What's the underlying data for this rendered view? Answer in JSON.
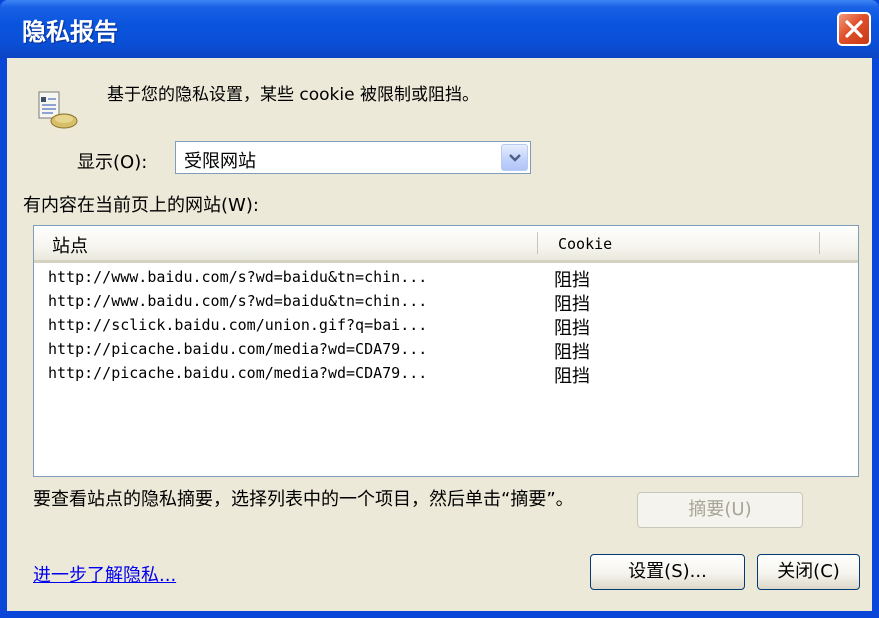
{
  "window": {
    "title": "隐私报告"
  },
  "intro": {
    "text": "基于您的隐私设置，某些 cookie 被限制或阻挡。"
  },
  "display": {
    "label": "显示(O):",
    "selected": "受限网站"
  },
  "list": {
    "label": "有内容在当前页上的网站(W):",
    "columns": [
      "站点",
      "Cookie"
    ],
    "rows": [
      {
        "site": "http://www.baidu.com/s?wd=baidu&tn=chin...",
        "status": "阻挡"
      },
      {
        "site": "http://www.baidu.com/s?wd=baidu&tn=chin...",
        "status": "阻挡"
      },
      {
        "site": "http://sclick.baidu.com/union.gif?q=bai...",
        "status": "阻挡"
      },
      {
        "site": "http://picache.baidu.com/media?wd=CDA79...",
        "status": "阻挡"
      },
      {
        "site": "http://picache.baidu.com/media?wd=CDA79...",
        "status": "阻挡"
      }
    ]
  },
  "summary": {
    "text": "要查看站点的隐私摘要，选择列表中的一个项目，然后单击“摘要”。",
    "button": "摘要(U)"
  },
  "footer": {
    "learn_more": "进一步了解隐私...",
    "settings_button": "设置(S)...",
    "close_button": "关闭(C)"
  },
  "icons": {
    "close": "close-icon",
    "privacy": "privacy-report-icon",
    "dropdown": "chevron-down-icon"
  },
  "colors": {
    "titlebar": "#0a55de",
    "window_border": "#0a46d8",
    "dialog_background": "#ece9d8",
    "close_button": "#e0502b",
    "link": "#0000ee"
  }
}
